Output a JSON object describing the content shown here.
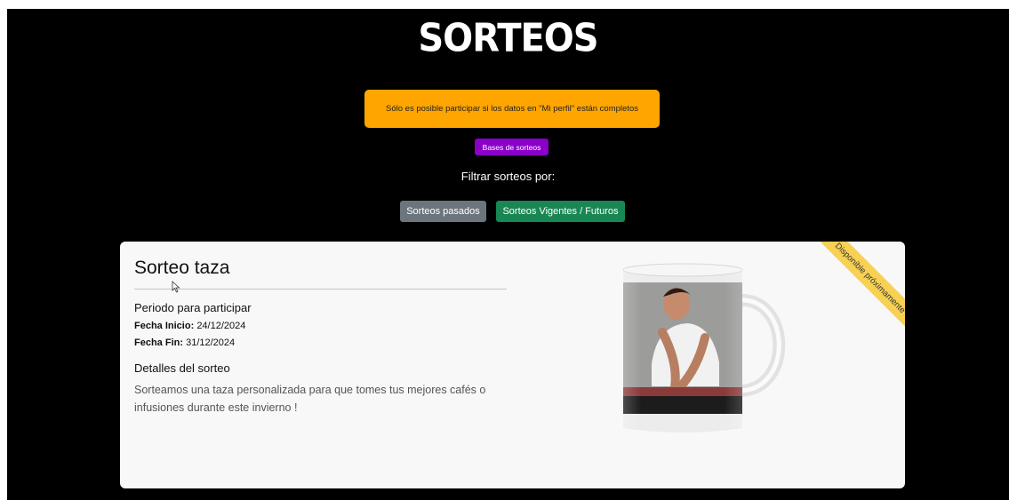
{
  "header": {
    "logo_text": "SORTEOS"
  },
  "alert": {
    "message": "Sólo es posible participar si los datos en \"Mi perfil\" están completos"
  },
  "bases_button": {
    "label": "Bases de sorteos"
  },
  "filters": {
    "label": "Filtrar sorteos por:",
    "past_label": "Sorteos pasados",
    "current_label": "Sorteos Vigentes / Futuros"
  },
  "raffle": {
    "title": "Sorteo taza",
    "period_title": "Periodo para participar",
    "start_label": "Fecha Inicio:",
    "start_date": "24/12/2024",
    "end_label": "Fecha Fin:",
    "end_date": "31/12/2024",
    "details_title": "Detalles del sorteo",
    "description": "Sorteamos una taza personalizada para que tomes tus mejores cafés o infusiones durante este invierno !",
    "status_ribbon": "Disponible próximamente"
  },
  "colors": {
    "alert_bg": "#ffa500",
    "bases_bg": "#8a00c8",
    "past_bg": "#6c757d",
    "current_bg": "#198754",
    "ribbon_bg": "#f7d154"
  }
}
